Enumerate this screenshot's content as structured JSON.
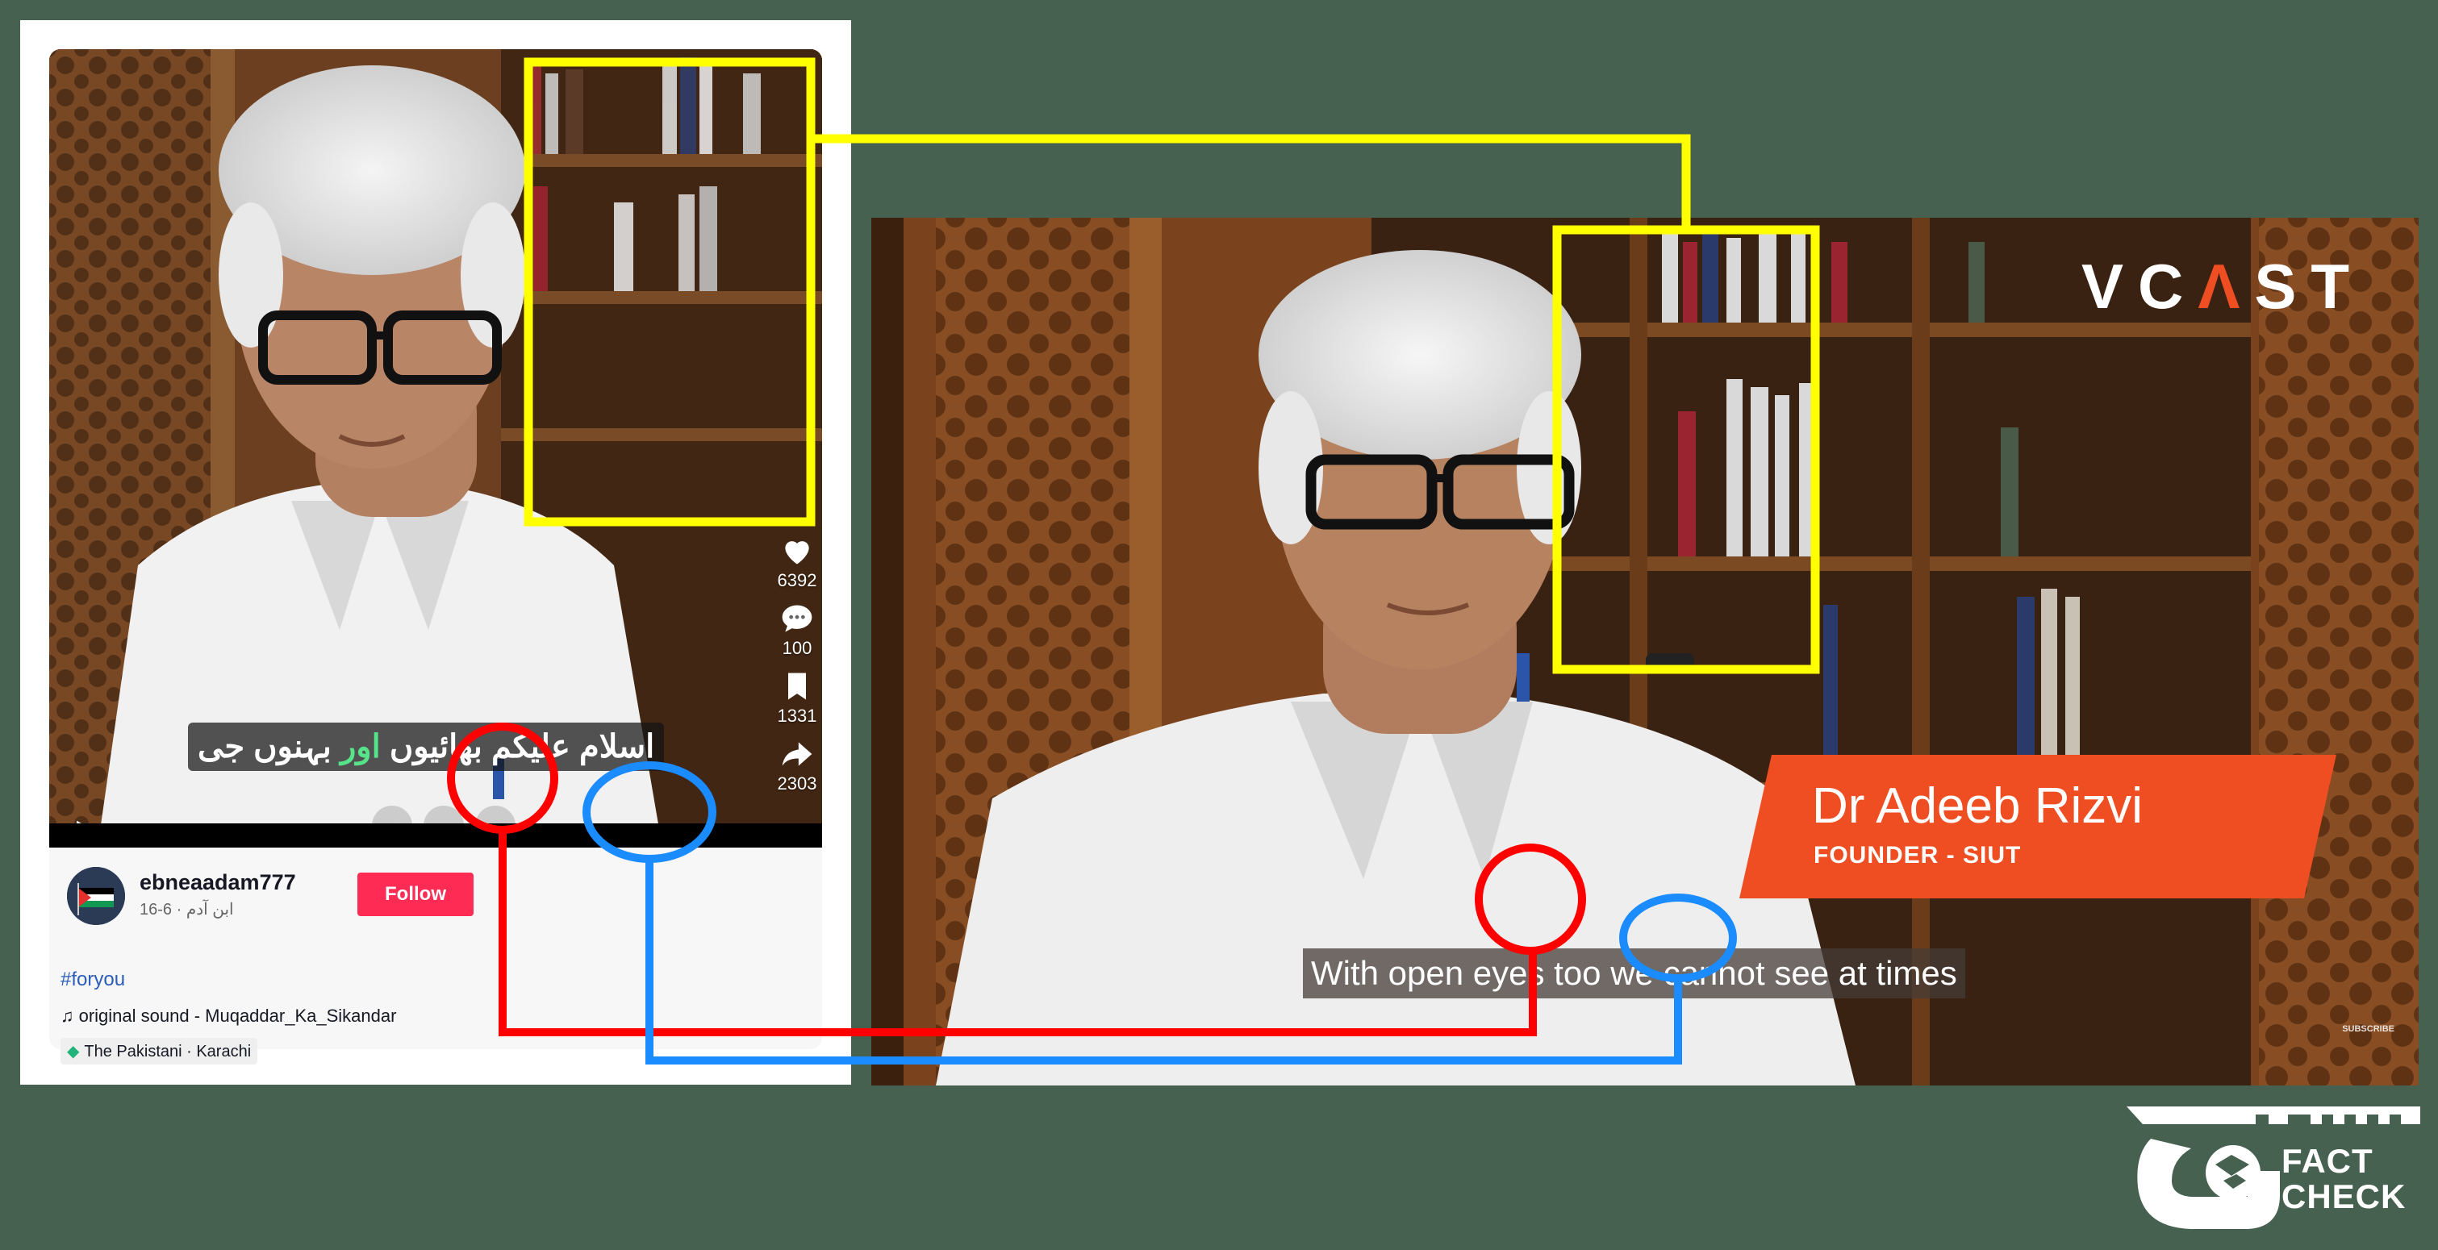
{
  "tiktok": {
    "stats": {
      "likes": "6392",
      "comments": "100",
      "saves": "1331",
      "shares": "2303"
    },
    "subtitle_before": "اسلام علیکم بھائیوں",
    "subtitle_highlight": "اور",
    "subtitle_after": "بہنوں جی",
    "username": "ebneaadam777",
    "subline": "ابن آدم · 6-16",
    "follow_label": "Follow",
    "hashtag": "#foryou",
    "sound": "♫ original sound - Muqaddar_Ka_Sikandar",
    "location": "The Pakistani · Karachi"
  },
  "vcast": {
    "logo_left": "VC",
    "logo_accent": "Λ",
    "logo_right": "ST",
    "name": "Dr Adeeb Rizvi",
    "title": "FOUNDER - SIUT",
    "caption": "With open eyes too we cannot see at times",
    "subscribe": "SUBSCRIBE"
  },
  "factcheck": {
    "word1": "FACT",
    "word2": "CHECK"
  },
  "colors": {
    "background": "#46614f",
    "highlight_yellow": "#ffff00",
    "highlight_red": "#ff0000",
    "highlight_blue": "#1a8cff",
    "follow": "#fe2c55",
    "lower_third": "#ef4e23"
  }
}
